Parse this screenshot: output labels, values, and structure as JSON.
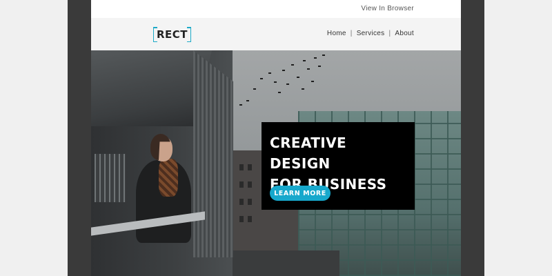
{
  "topbar": {
    "view_in_browser": "View In Browser"
  },
  "header": {
    "logo_text": "RECT",
    "nav": [
      {
        "label": "Home"
      },
      {
        "label": "Services"
      },
      {
        "label": "About"
      }
    ],
    "separator": "|"
  },
  "hero": {
    "headline": "CREATIVE DESIGN\nFOR BUSINESS",
    "button_label": "LEARN MORE",
    "image_description_icon": "urban-balcony-photo"
  },
  "colors": {
    "accent": "#17a8cc",
    "frame": "#3a3a3a",
    "page_background": "#f0f0f0",
    "header_background": "#f4f4f4",
    "cta_background": "#000000"
  }
}
